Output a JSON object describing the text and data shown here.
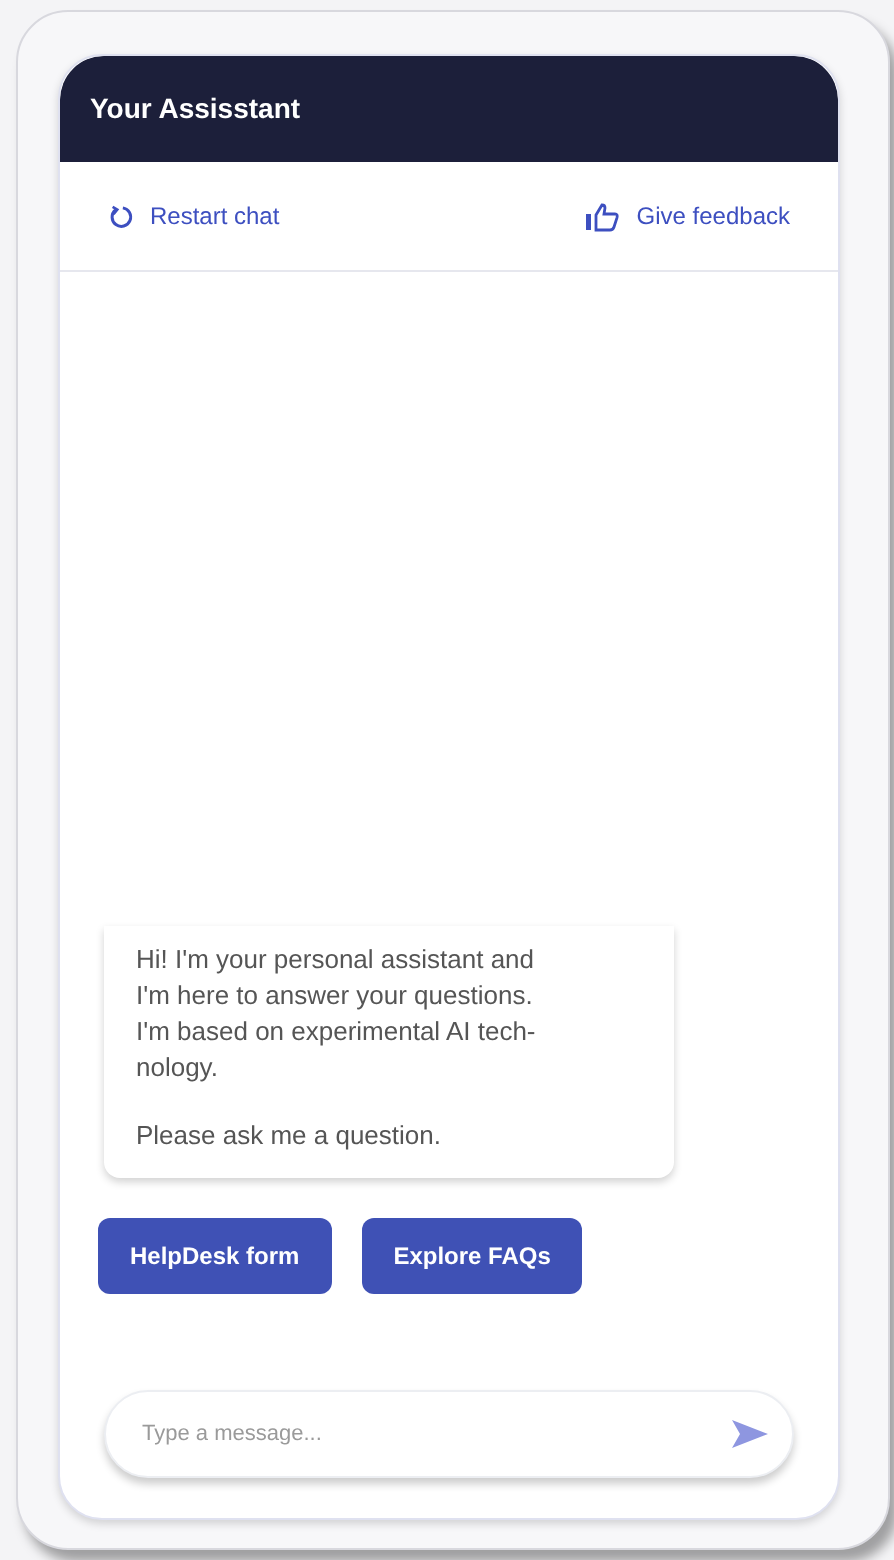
{
  "header": {
    "title": "Your Assisstant"
  },
  "actions": [
    {
      "kind": "restart",
      "label": "Restart chat"
    },
    {
      "kind": "feedback",
      "label": "Give feedback"
    }
  ],
  "message": {
    "paragraphs": [
      "Hi! I'm your personal assistant and\nI'm here to answer your questions.\nI'm based on experimental AI tech-\nnology.",
      "Please ask me a question."
    ]
  },
  "quick_replies": [
    "HelpDesk form",
    "Explore FAQs"
  ],
  "composer": {
    "placeholder": "Type a message..."
  }
}
